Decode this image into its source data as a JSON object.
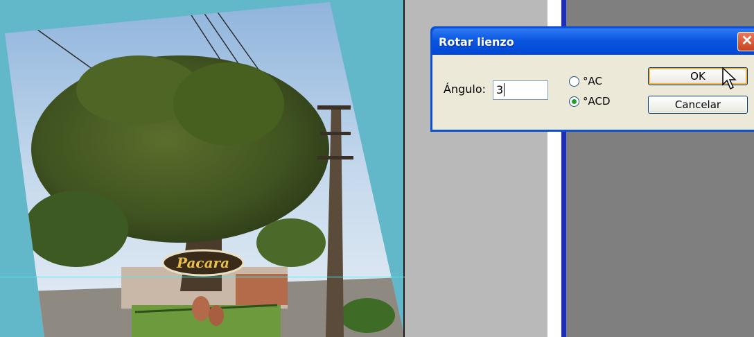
{
  "dialog": {
    "title": "Rotar lienzo",
    "close_symbol": "✕",
    "angle_label": "Ángulo:",
    "angle_value": "3",
    "radio_cw_label": "°AC",
    "radio_ccw_label": "°ACD",
    "selected_option": "°ACD",
    "ok_label": "OK",
    "cancel_label": "Cancelar"
  },
  "photo": {
    "sign_text": "Pacara"
  },
  "icons": {
    "cursor": "arrow-cursor-icon",
    "close": "close-icon"
  },
  "colors": {
    "canvas_background": "#62b7c9",
    "title_bar": "#0a56e0",
    "close_button": "#d8542f",
    "guide_line": "#58e6e8"
  }
}
